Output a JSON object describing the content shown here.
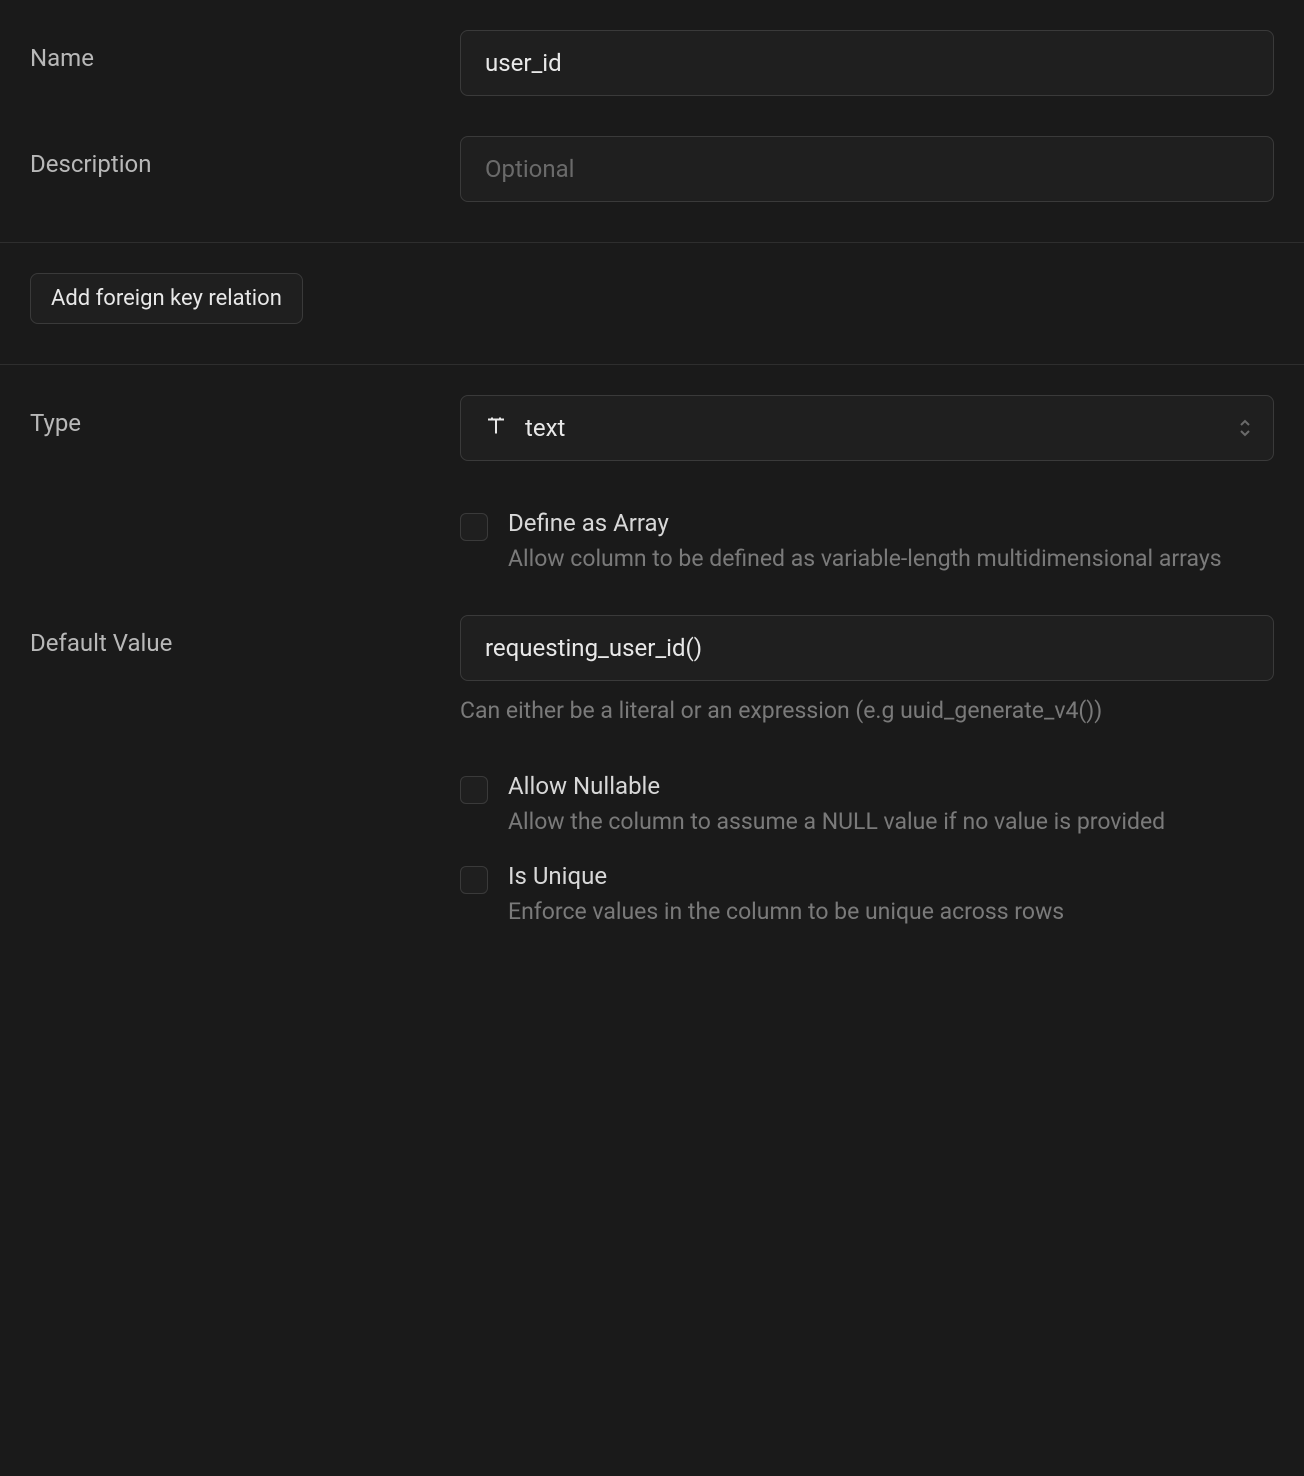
{
  "fields": {
    "name": {
      "label": "Name",
      "value": "user_id"
    },
    "description": {
      "label": "Description",
      "placeholder": "Optional",
      "value": ""
    },
    "foreign_key": {
      "button_label": "Add foreign key relation"
    },
    "type": {
      "label": "Type",
      "value": "text"
    },
    "define_array": {
      "title": "Define as Array",
      "description": "Allow column to be defined as variable-length multidimensional arrays"
    },
    "default_value": {
      "label": "Default Value",
      "value": "requesting_user_id()",
      "helper": "Can either be a literal or an expression (e.g uuid_generate_v4())"
    },
    "allow_nullable": {
      "title": "Allow Nullable",
      "description": "Allow the column to assume a NULL value if no value is provided"
    },
    "is_unique": {
      "title": "Is Unique",
      "description": "Enforce values in the column to be unique across rows"
    }
  }
}
